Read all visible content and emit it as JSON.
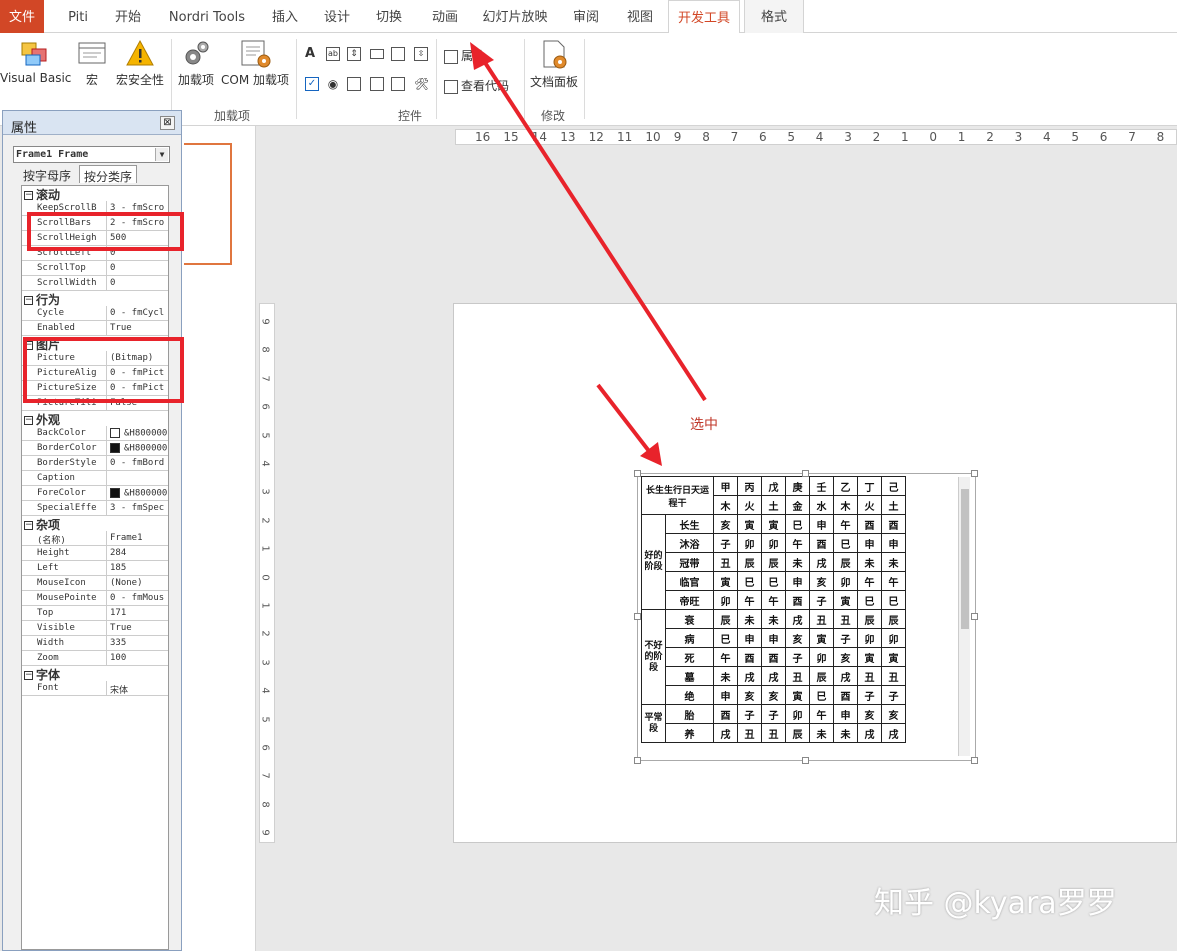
{
  "ribbon_tabs": [
    "文件",
    "Piti",
    "开始",
    "Nordri Tools",
    "插入",
    "设计",
    "切换",
    "动画",
    "幻灯片放映",
    "审阅",
    "视图",
    "开发工具",
    "格式"
  ],
  "ribbon": {
    "code": {
      "visual_basic": "Visual Basic",
      "macro": "宏",
      "macro_security": "宏安全性"
    },
    "addins": {
      "addins": "加载项",
      "com_addins": "COM 加载项",
      "label": "加载项"
    },
    "controls": {
      "properties": "属性",
      "view_code": "查看代码",
      "label": "控件"
    },
    "modify": {
      "document_panel": "文档面板",
      "label": "修改"
    }
  },
  "properties_panel": {
    "title": "属性",
    "object_selector": "Frame1 Frame",
    "tabs": [
      "按字母序",
      "按分类序"
    ],
    "categories": [
      {
        "name": "滚动",
        "rows": [
          [
            "KeepScrollB",
            "3 - fmScro"
          ],
          [
            "ScrollBars",
            "2 - fmScro"
          ],
          [
            "ScrollHeigh",
            "500"
          ],
          [
            "ScrollLeft",
            "0"
          ],
          [
            "ScrollTop",
            "0"
          ],
          [
            "ScrollWidth",
            "0"
          ]
        ]
      },
      {
        "name": "行为",
        "rows": [
          [
            "Cycle",
            "0 - fmCycl"
          ],
          [
            "Enabled",
            "True"
          ]
        ]
      },
      {
        "name": "图片",
        "rows": [
          [
            "Picture",
            "(Bitmap)"
          ],
          [
            "PictureAlig",
            "0 - fmPict"
          ],
          [
            "PictureSize",
            "0 - fmPict"
          ],
          [
            "PictureTili",
            "False"
          ]
        ]
      },
      {
        "name": "外观",
        "rows": [
          [
            "BackColor",
            "&H800000"
          ],
          [
            "BorderColor",
            "&H800000"
          ],
          [
            "BorderStyle",
            "0 - fmBord"
          ],
          [
            "Caption",
            ""
          ],
          [
            "ForeColor",
            "&H800000"
          ],
          [
            "SpecialEffe",
            "3 - fmSpec"
          ]
        ]
      },
      {
        "name": "杂项",
        "rows": [
          [
            "(名称)",
            "Frame1"
          ],
          [
            "Height",
            "284"
          ],
          [
            "Left",
            "185"
          ],
          [
            "MouseIcon",
            "(None)"
          ],
          [
            "MousePointe",
            "0 - fmMous"
          ],
          [
            "Top",
            "171"
          ],
          [
            "Visible",
            "True"
          ],
          [
            "Width",
            "335"
          ],
          [
            "Zoom",
            "100"
          ]
        ]
      },
      {
        "name": "字体",
        "rows": [
          [
            "Font",
            "宋体"
          ]
        ]
      }
    ]
  },
  "selected_label": "选中",
  "hruler_labels": [
    "16",
    "15",
    "14",
    "13",
    "12",
    "11",
    "10",
    "9",
    "8",
    "7",
    "6",
    "5",
    "4",
    "3",
    "2",
    "1",
    "0",
    "1",
    "2",
    "3",
    "4",
    "5",
    "6",
    "7",
    "8"
  ],
  "vruler_labels": [
    "9",
    "8",
    "7",
    "6",
    "5",
    "4",
    "3",
    "2",
    "1",
    "0",
    "1",
    "2",
    "3",
    "4",
    "5",
    "6",
    "7",
    "8",
    "9"
  ],
  "table": {
    "header_row1": [
      "甲",
      "丙",
      "戊",
      "庚",
      "壬",
      "乙",
      "丁",
      "己"
    ],
    "header_row2": [
      "木",
      "火",
      "土",
      "金",
      "水",
      "木",
      "火",
      "土"
    ],
    "corner": [
      "长生",
      "生",
      "行",
      "日",
      "天",
      "运",
      "程",
      "干"
    ],
    "groups": [
      {
        "label": "好的阶段",
        "rows": [
          [
            "长生",
            "亥",
            "寅",
            "寅",
            "巳",
            "申",
            "午",
            "酉",
            "酉"
          ],
          [
            "沐浴",
            "子",
            "卯",
            "卯",
            "午",
            "酉",
            "巳",
            "申",
            "申"
          ],
          [
            "冠带",
            "丑",
            "辰",
            "辰",
            "未",
            "戌",
            "辰",
            "未",
            "未"
          ],
          [
            "临官",
            "寅",
            "巳",
            "巳",
            "申",
            "亥",
            "卯",
            "午",
            "午"
          ],
          [
            "帝旺",
            "卯",
            "午",
            "午",
            "酉",
            "子",
            "寅",
            "巳",
            "巳"
          ]
        ]
      },
      {
        "label": "不好的阶段",
        "rows": [
          [
            "衰",
            "辰",
            "未",
            "未",
            "戌",
            "丑",
            "丑",
            "辰",
            "辰"
          ],
          [
            "病",
            "巳",
            "申",
            "申",
            "亥",
            "寅",
            "子",
            "卯",
            "卯"
          ],
          [
            "死",
            "午",
            "酉",
            "酉",
            "子",
            "卯",
            "亥",
            "寅",
            "寅"
          ],
          [
            "墓",
            "未",
            "戌",
            "戌",
            "丑",
            "辰",
            "戌",
            "丑",
            "丑"
          ],
          [
            "绝",
            "申",
            "亥",
            "亥",
            "寅",
            "巳",
            "酉",
            "子",
            "子"
          ]
        ]
      },
      {
        "label": "平常段",
        "rows": [
          [
            "胎",
            "酉",
            "子",
            "子",
            "卯",
            "午",
            "申",
            "亥",
            "亥"
          ],
          [
            "养",
            "戌",
            "丑",
            "丑",
            "辰",
            "未",
            "未",
            "戌",
            "戌"
          ]
        ]
      }
    ]
  },
  "watermark": "知乎 @kyara罗罗",
  "colors": {
    "accent": "#d24726",
    "highlight_box": "#e8232b",
    "arrow": "#e8232b"
  }
}
